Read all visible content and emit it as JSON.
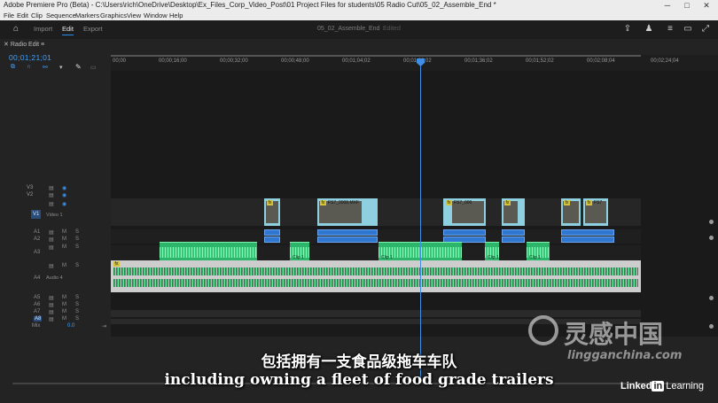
{
  "window": {
    "title": "Adobe Premiere Pro (Beta) - C:\\Users\\rich\\OneDrive\\Desktop\\Ex_Files_Corp_Video_Post\\01 Project Files for students\\05 Radio Cut\\05_02_Assemble_End *",
    "controls": {
      "minimize": "─",
      "maximize": "□",
      "close": "✕"
    }
  },
  "menu": [
    "File",
    "Edit",
    "Clip",
    "Sequence",
    "Markers",
    "Graphics",
    "View",
    "Window",
    "Help"
  ],
  "workspace": {
    "tabs": [
      "Import",
      "Edit",
      "Export"
    ],
    "active_tab": "Edit",
    "document_name": "05_02_Assemble_End",
    "document_status": "Edited"
  },
  "panel": {
    "tab_label": "Radio Edit",
    "timecode": "00;01;21;01"
  },
  "ruler": [
    "00;00",
    "00;00;16;00",
    "00;00;32;00",
    "00;00;48;00",
    "00;01;04;02",
    "00;01;20;02",
    "00;01;36;02",
    "00;01;52;02",
    "00;02;08;04",
    "00;02;24;04"
  ],
  "tracks": {
    "video": [
      {
        "id": "V3",
        "name": ""
      },
      {
        "id": "V2",
        "name": ""
      },
      {
        "id": "V1",
        "name": "Video 1"
      }
    ],
    "audio": [
      {
        "id": "A1",
        "name": ""
      },
      {
        "id": "A2",
        "name": ""
      },
      {
        "id": "A3",
        "name": ""
      },
      {
        "id": "A4",
        "name": "Audio 4"
      },
      {
        "id": "A5",
        "name": ""
      },
      {
        "id": "A6",
        "name": ""
      },
      {
        "id": "A7",
        "name": ""
      },
      {
        "id": "A8",
        "name": ""
      }
    ],
    "mix_label": "Mix",
    "mix_value": "0.0",
    "toggle_m": "M",
    "toggle_s": "S"
  },
  "clips": {
    "fx_badge": "fx",
    "v1": [
      "",
      "FS7_0008.MXF",
      "FS7_000",
      "",
      "",
      "FS7"
    ],
    "a3": [
      "",
      "Clip 1",
      "Clip 1",
      "Clip 1",
      "Clip 1"
    ]
  },
  "subtitles": {
    "chinese": "包括拥有一支食品级拖车车队",
    "english": "including owning a fleet of food grade trailers"
  },
  "watermark": {
    "brand": "灵感中国",
    "url": "lingganchina.com"
  },
  "linkedin": {
    "in": "in",
    "word1": "Linked",
    "word2": "Learning"
  },
  "colors": {
    "accent": "#2d8ceb",
    "video_clip": "#8fd0e0",
    "audio_clip": "#2db56b",
    "playhead": "#3f8fe6"
  }
}
